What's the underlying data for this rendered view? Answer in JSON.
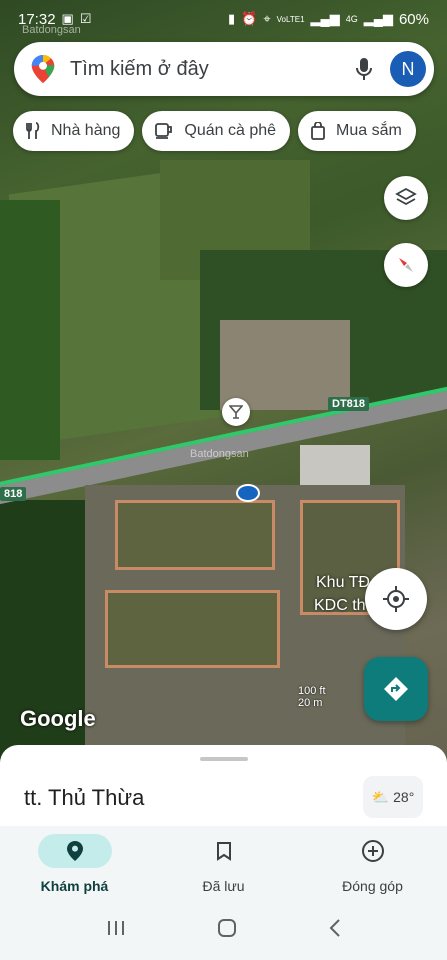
{
  "status": {
    "time": "17:32",
    "battery": "60%",
    "network": "4G",
    "signal_label": "VoLTE1"
  },
  "watermark": "Batdongsan",
  "search": {
    "placeholder": "Tìm kiếm ở đây",
    "avatar_letter": "N"
  },
  "chips": [
    {
      "label": "Nhà hàng",
      "icon": "fork-knife-icon"
    },
    {
      "label": "Quán cà phê",
      "icon": "coffee-cup-icon"
    },
    {
      "label": "Mua sắm",
      "icon": "shopping-bag-icon"
    }
  ],
  "map": {
    "road_label_1": "DT818",
    "road_label_2": "818",
    "area_label_1": "Khu TĐ",
    "area_label_2": "KDC th",
    "google": "Google",
    "scale_top": "100 ft",
    "scale_bottom": "20 m"
  },
  "sheet": {
    "place_name": "tt. Thủ Thừa",
    "temperature": "28°"
  },
  "nav": [
    {
      "label": "Khám phá",
      "icon": "location-pin-icon",
      "active": true
    },
    {
      "label": "Đã lưu",
      "icon": "bookmark-icon",
      "active": false
    },
    {
      "label": "Đóng góp",
      "icon": "add-circle-icon",
      "active": false
    }
  ],
  "colors": {
    "accent": "#0d7c7a",
    "nav_active_bg": "#c3ecea",
    "avatar_bg": "#1a5db4"
  }
}
